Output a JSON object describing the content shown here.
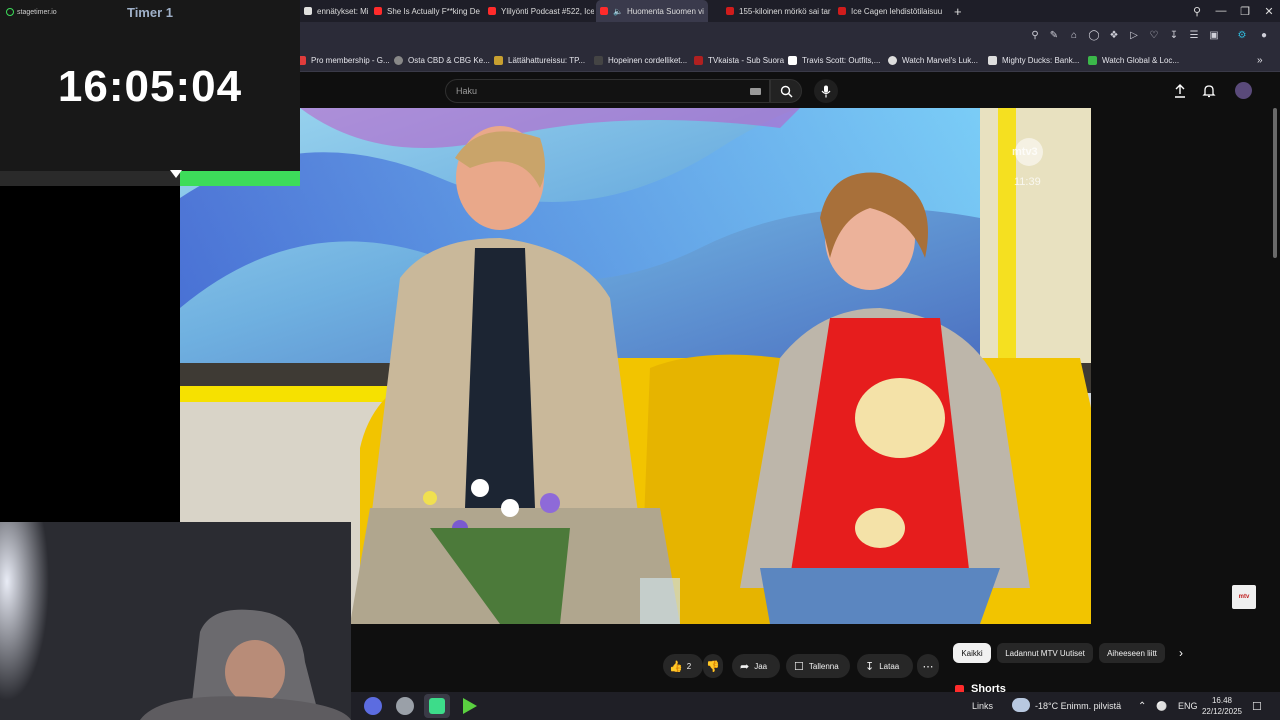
{
  "browser": {
    "tabs": [
      {
        "label": "ennätykset: Mitkä l",
        "icon_color": "#e0e0e0"
      },
      {
        "label": "She Is Actually F**king De",
        "icon_color": "#ff2b2b"
      },
      {
        "label": "Ylilyönti Podcast #522, Ice",
        "icon_color": "#ff2b2b"
      },
      {
        "label": "Huomenta Suomen vi",
        "icon_color": "#ff2b2b",
        "active": true
      },
      {
        "label": "155-kiloinen mörkö sai tar",
        "icon_color": "#d01c1c"
      },
      {
        "label": "Ice Cagen lehdistötilaisuu",
        "icon_color": "#d01c1c"
      }
    ],
    "new_tab": "+",
    "window_controls": [
      "search-icon",
      "minimize-icon",
      "restore-icon",
      "close-icon"
    ],
    "bookmarks": [
      {
        "label": "Pro membership - G...",
        "icon_color": "#e03c3c"
      },
      {
        "label": "Osta CBD & CBG Ke...",
        "icon_color": "#888888"
      },
      {
        "label": "Lättähattureissu: TP...",
        "icon_color": "#c8a030"
      },
      {
        "label": "Hopeinen cordelliket...",
        "icon_color": "#444444"
      },
      {
        "label": "TVkaista - Sub Suora",
        "icon_color": "#b02020"
      },
      {
        "label": "Travis Scott: Outfits,...",
        "icon_color": "#ffffff"
      },
      {
        "label": "Watch Marvel's Luk...",
        "icon_color": "#dddddd"
      },
      {
        "label": "Mighty Ducks: Bank...",
        "icon_color": "#dddddd"
      },
      {
        "label": "Watch Global & Loc...",
        "icon_color": "#3bb84a"
      }
    ]
  },
  "timer": {
    "brand": "stagetimer.io",
    "title": "Timer 1",
    "time": "16:05:04",
    "progress": 0.4,
    "accent": "#3ddc5a"
  },
  "youtube": {
    "search_placeholder": "Haku",
    "video_overlay": {
      "channel_logo": "mtv3",
      "clock": "11:39"
    },
    "actions": {
      "likes": "2",
      "share": "Jaa",
      "save": "Tallenna",
      "download": "Lataa"
    },
    "chips": [
      "Kaikki",
      "Ladannut MTV Uutiset",
      "Aiheeseen liitt"
    ],
    "shorts_label": "Shorts",
    "watermark": "mtv"
  },
  "taskbar": {
    "links_label": "Links",
    "weather": "-18°C  Enimm. pilvistä",
    "language": "ENG",
    "time": "16.48",
    "date": "22/12/2025"
  }
}
